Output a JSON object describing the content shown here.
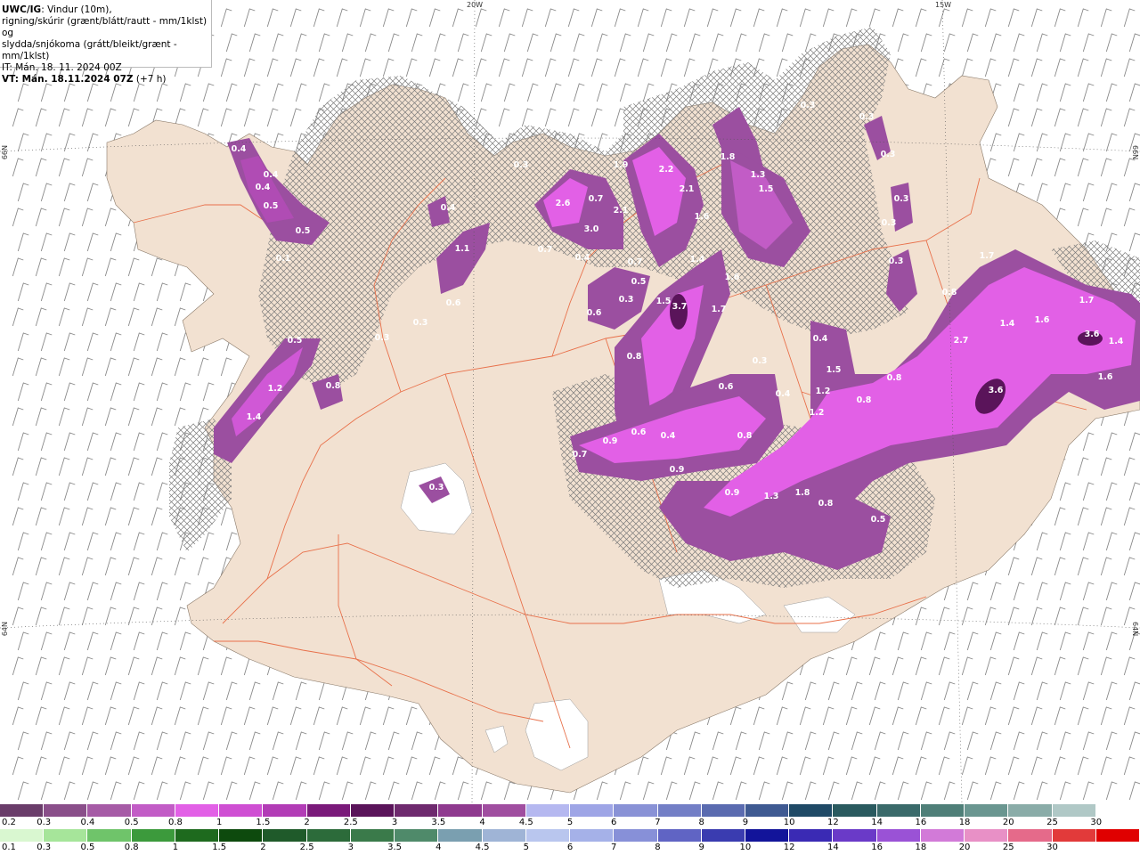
{
  "title": {
    "line1_bold": "UWC/IG",
    "line1_rest": ": Vindur (10m),",
    "line2": "rigning/skúrir (grænt/blátt/rautt - mm/1klst) og",
    "line3": "slydda/snjókoma (grátt/bleikt/grænt - mm/1klst)",
    "line4": "IT: Mán. 18. 11. 2024 00Z",
    "line5_bold": "VT: Mán. 18.11.2024 07Z",
    "line5_rest": " (+7 h)"
  },
  "graticule": {
    "lon_20w": "20W",
    "lon_15w": "15W",
    "lat_66n": "66N",
    "lat_64n": "64N"
  },
  "precip_labels": [
    "0.4",
    "0.4",
    "0.4",
    "0.5",
    "0.5",
    "0.1",
    "0.4",
    "1.1",
    "0.6",
    "0.3",
    "0.3",
    "0.5",
    "1.2",
    "1.4",
    "0.8",
    "0.3",
    "2.6",
    "0.7",
    "1.9",
    "2.2",
    "2.1",
    "1.8",
    "1.3",
    "1.5",
    "0.3",
    "2.1",
    "3.0",
    "1.6",
    "0.4",
    "0.7",
    "0.5",
    "0.3",
    "1.4",
    "0.6",
    "1.5",
    "3.7",
    "1.6",
    "1.7",
    "0.7",
    "0.8",
    "0.3",
    "0.3",
    "0.3",
    "0.3",
    "0.3",
    "1.7",
    "0.8",
    "1.4",
    "1.6",
    "1.7",
    "3.6",
    "1.4",
    "1.6",
    "2.7",
    "3.6",
    "0.4",
    "1.5",
    "0.8",
    "0.3",
    "0.4",
    "1.2",
    "0.6",
    "1.2",
    "0.8",
    "0.9",
    "0.6",
    "0.4",
    "0.8",
    "0.7",
    "0.9",
    "1.3",
    "1.8",
    "0.8",
    "0.9",
    "0.5",
    "0.3"
  ],
  "colorbar_snow": {
    "labels": [
      "0.2",
      "0.3",
      "0.4",
      "0.5",
      "0.8",
      "1",
      "1.5",
      "2",
      "2.5",
      "3",
      "3.5",
      "4",
      "4.5",
      "5",
      "6",
      "7",
      "8",
      "9",
      "10",
      "12",
      "14",
      "16",
      "18",
      "20",
      "25",
      "30"
    ],
    "colors": [
      "#6a3d6a",
      "#8a4f8a",
      "#a65ba6",
      "#c25cc6",
      "#e260e6",
      "#cf4fd3",
      "#b23cb6",
      "#7a1a7a",
      "#5a145a",
      "#6e2a6e",
      "#8f3a8f",
      "#a04ea0",
      "#b5b8f0",
      "#9ea5e6",
      "#8992d6",
      "#737fc6",
      "#5a6bb0",
      "#3f5a92",
      "#1f4a66",
      "#2a5a5f",
      "#3a6a6a",
      "#4f7f78",
      "#6a9690",
      "#8aaca8",
      "#b0c8c6",
      "#ffffff"
    ]
  },
  "colorbar_rain": {
    "labels": [
      "0.1",
      "0.3",
      "0.5",
      "0.8",
      "1",
      "1.5",
      "2",
      "2.5",
      "3",
      "3.5",
      "4",
      "4.5",
      "5",
      "6",
      "7",
      "8",
      "9",
      "10",
      "12",
      "14",
      "16",
      "18",
      "20",
      "25",
      "30"
    ],
    "colors": [
      "#d9f7d0",
      "#a6e59a",
      "#6fc46a",
      "#3c9a3c",
      "#1e6a1e",
      "#0d4a0d",
      "#1f5a2a",
      "#2c6b3a",
      "#3a7a4a",
      "#4f8a6a",
      "#7a9fb0",
      "#9fb4d6",
      "#b9c6ee",
      "#a5b1e8",
      "#8790d8",
      "#6064c4",
      "#3a3cb0",
      "#12149a",
      "#3a2ab4",
      "#6a3ac8",
      "#9a52d6",
      "#d27ad8",
      "#e890c6",
      "#e56a8a",
      "#e23a3a",
      "#e00000"
    ]
  },
  "colors": {
    "land": "#f2e1d1",
    "sea": "#ffffff",
    "roads": "#e8704a",
    "hatch": "#6e6e6e",
    "precip_light": "#c25cc6",
    "precip_mid": "#e260e6",
    "precip_dark": "#5a145a"
  }
}
